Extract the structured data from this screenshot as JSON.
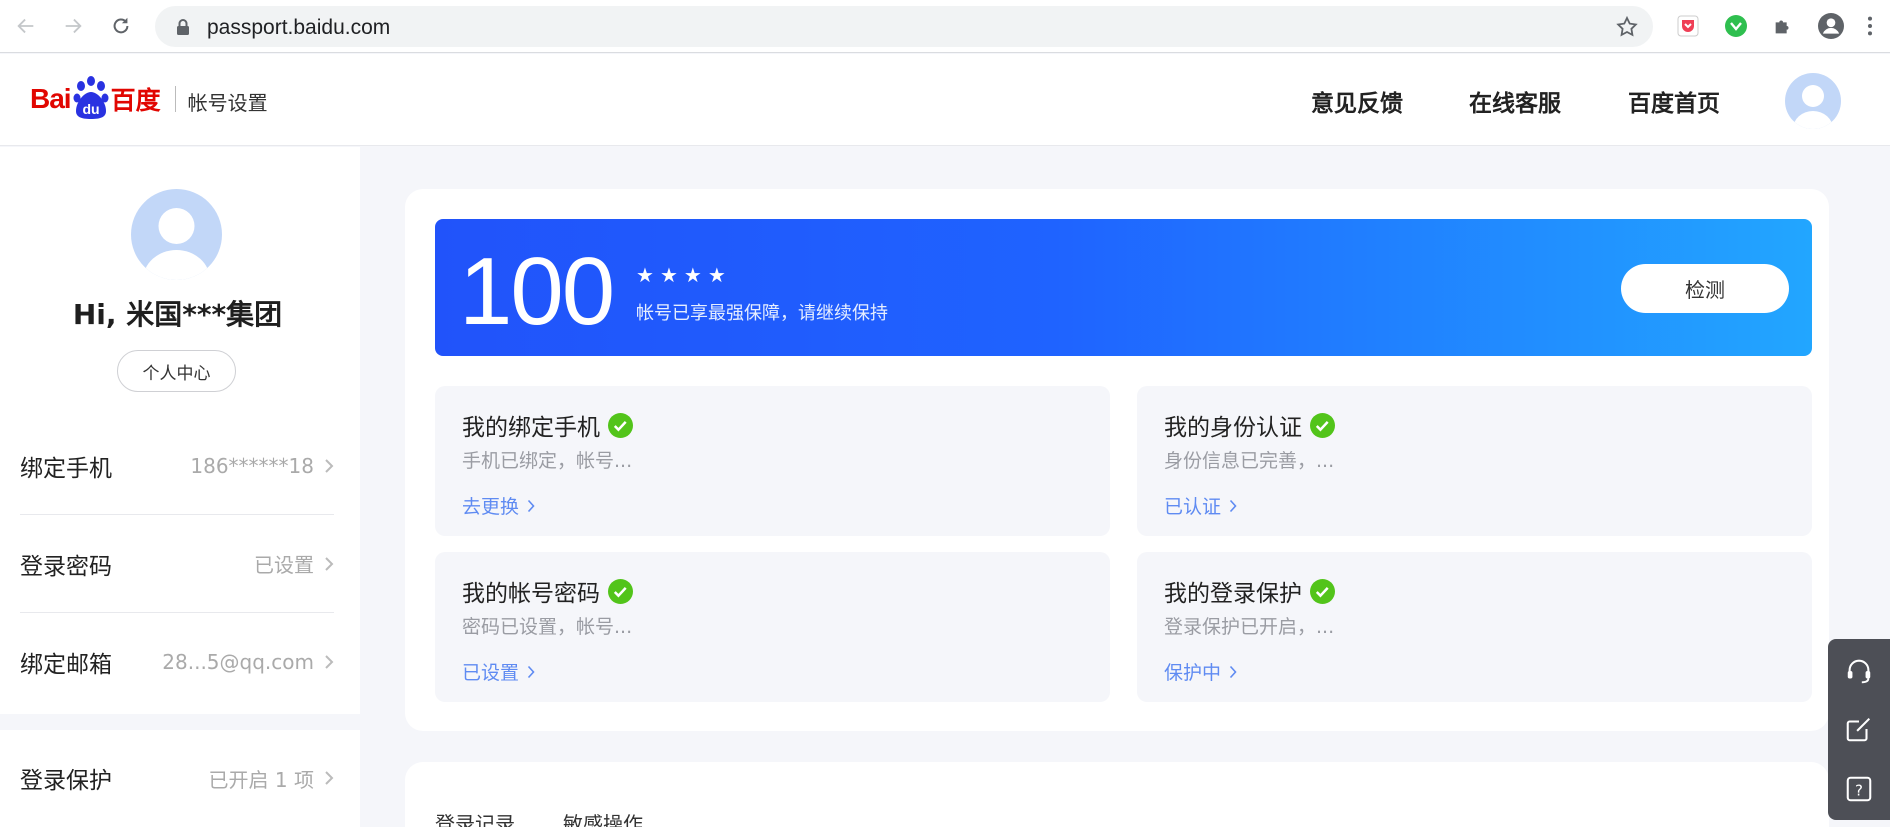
{
  "browser": {
    "url": "passport.baidu.com"
  },
  "header": {
    "logo_text_bai": "Bai",
    "logo_text_du": "du",
    "logo_text_cn": "百度",
    "subtitle": "帐号设置",
    "links": [
      "意见反馈",
      "在线客服",
      "百度首页"
    ]
  },
  "sidebar": {
    "greeting": "Hi, 米国***集团",
    "center_button": "个人中心",
    "rows": [
      {
        "label": "绑定手机",
        "value": "186******18"
      },
      {
        "label": "登录密码",
        "value": "已设置"
      },
      {
        "label": "绑定邮箱",
        "value": "28...5@qq.com"
      },
      {
        "label": "登录保护",
        "value": "已开启 1 项"
      }
    ]
  },
  "score": {
    "value": "100",
    "stars": 4,
    "message": "帐号已享最强保障，请继续保持",
    "detect_button": "检测"
  },
  "cards": [
    {
      "title": "我的绑定手机",
      "desc": "手机已绑定，帐号...",
      "link": "去更换"
    },
    {
      "title": "我的身份认证",
      "desc": "身份信息已完善，...",
      "link": "已认证"
    },
    {
      "title": "我的帐号密码",
      "desc": "密码已设置，帐号...",
      "link": "已设置"
    },
    {
      "title": "我的登录保护",
      "desc": "登录保护已开启，...",
      "link": "保护中"
    }
  ],
  "lower_tabs": [
    "登录记录",
    "敏感操作"
  ],
  "colors": {
    "brand_red": "#e10601",
    "banner_start": "#2153fa",
    "banner_end": "#22a6ff",
    "link_blue": "#5f8bf2",
    "check_green": "#52c41a",
    "float_panel": "#4d4f56"
  },
  "icons": {
    "float_tools": [
      "headset-icon",
      "edit-icon",
      "help-icon"
    ]
  }
}
